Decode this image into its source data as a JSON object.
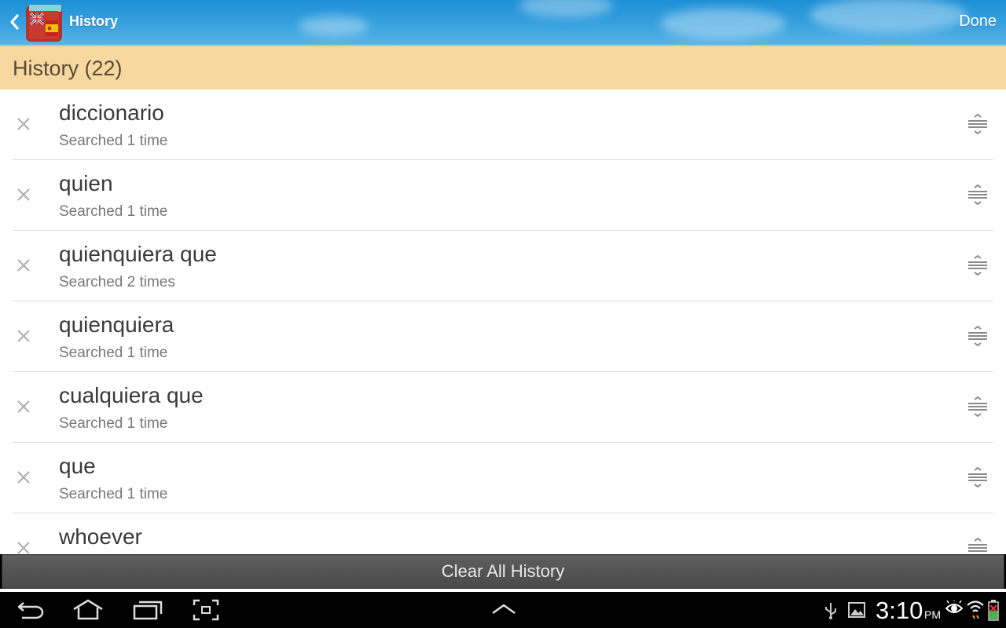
{
  "action_bar": {
    "title": "History",
    "done_label": "Done",
    "icons": [
      "back-chevron-icon",
      "app-dictionary-icon"
    ]
  },
  "section": {
    "title": "History (22)"
  },
  "history": [
    {
      "word": "diccionario",
      "count": "Searched 1 time"
    },
    {
      "word": "quien",
      "count": "Searched 1 time"
    },
    {
      "word": "quienquiera que",
      "count": "Searched 2 times"
    },
    {
      "word": "quienquiera",
      "count": "Searched 1 time"
    },
    {
      "word": "cualquiera que",
      "count": "Searched 1 time"
    },
    {
      "word": "que",
      "count": "Searched 1 time"
    },
    {
      "word": "whoever",
      "count": ""
    }
  ],
  "clear_all_label": "Clear All History",
  "system_bar": {
    "time": "3:10",
    "ampm": "PM",
    "icons": [
      "back-icon",
      "home-icon",
      "recent-apps-icon",
      "screenshot-icon",
      "up-arrow-icon",
      "usb-icon",
      "gallery-icon",
      "eye-icon",
      "wifi-icon",
      "battery-icon"
    ]
  },
  "colors": {
    "action_bar": "#2f9bdd",
    "section_header": "#f7d89e",
    "section_text": "#5a4a3a",
    "clear_button": "#525252"
  }
}
